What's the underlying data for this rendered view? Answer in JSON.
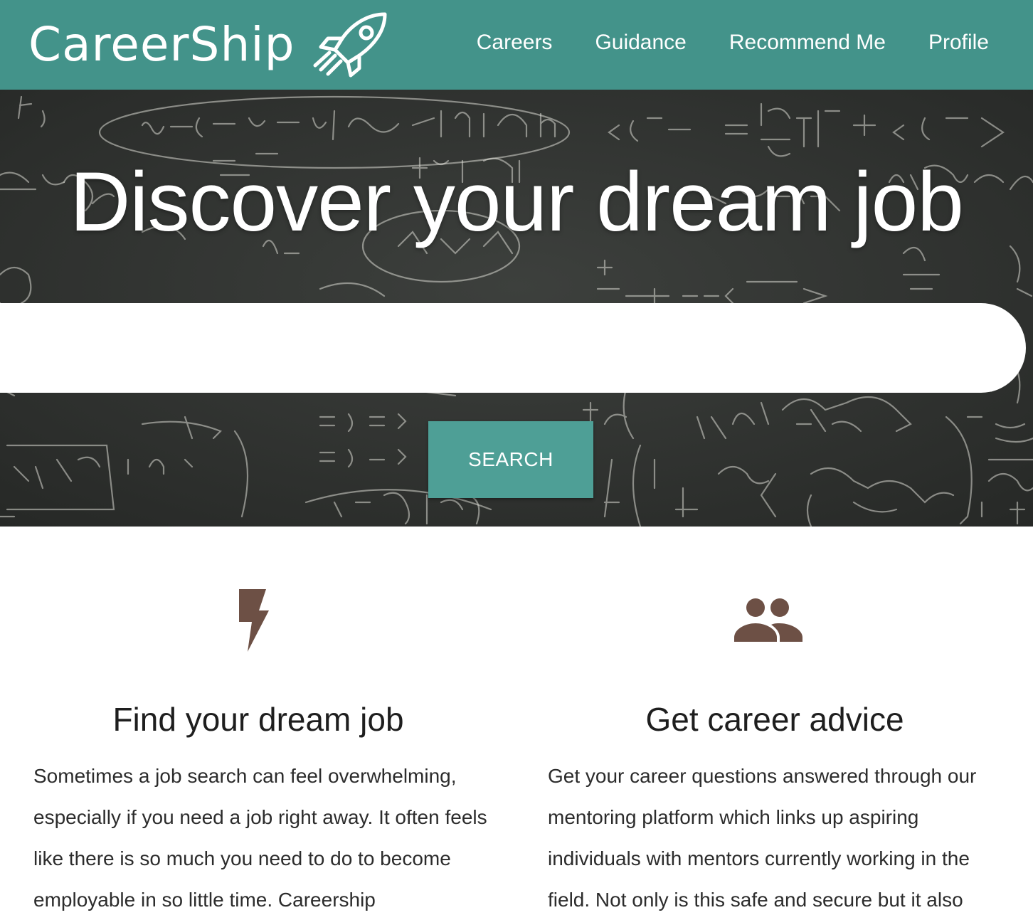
{
  "brand": {
    "name": "CareerShip",
    "logo_icon": "rocket-icon"
  },
  "nav": {
    "items": [
      {
        "label": "Careers"
      },
      {
        "label": "Guidance"
      },
      {
        "label": "Recommend Me"
      },
      {
        "label": "Profile"
      }
    ]
  },
  "hero": {
    "title": "Discover your dream job",
    "search_placeholder": "",
    "search_value": "",
    "search_button": "SEARCH"
  },
  "features": [
    {
      "icon": "lightning-bolt-icon",
      "title": "Find your dream job",
      "text": "Sometimes a job search can feel overwhelming, especially if you need a job right away. It often feels like there is so much you need to do to become employable in so little time. Careership"
    },
    {
      "icon": "people-group-icon",
      "title": "Get career advice",
      "text": "Get your career questions answered through our mentoring platform which links up aspiring individuals with mentors currently working in the field. Not only is this safe and secure but it also"
    }
  ],
  "colors": {
    "navbar": "#43938a",
    "search_button": "#4e9f96",
    "icon_brown": "#6d5045",
    "chalkboard": "#343734"
  }
}
